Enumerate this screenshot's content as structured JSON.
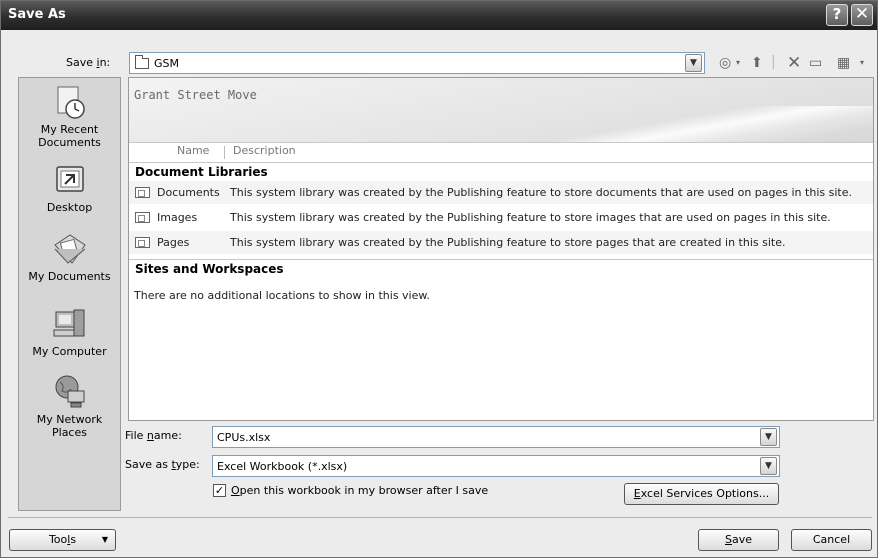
{
  "window": {
    "title": "Save As",
    "help_label": "?",
    "close_label": "✕"
  },
  "save_in": {
    "label_pre": "Save ",
    "label_key": "i",
    "label_post": "n:",
    "value": "GSM"
  },
  "places": [
    {
      "label": "My Recent Documents",
      "icon": "recent-documents-icon"
    },
    {
      "label": "Desktop",
      "icon": "desktop-icon"
    },
    {
      "label": "My Documents",
      "icon": "my-documents-icon"
    },
    {
      "label": "My Computer",
      "icon": "my-computer-icon"
    },
    {
      "label": "My Network Places",
      "icon": "network-places-icon"
    }
  ],
  "site": {
    "title": "Grant Street Move",
    "columns": [
      "Name",
      "Description"
    ],
    "groups": [
      {
        "heading": "Document Libraries",
        "rows": [
          {
            "name": "Documents",
            "description": "This system library was created by the Publishing feature to store documents that are used on pages in this site."
          },
          {
            "name": "Images",
            "description": "This system library was created by the Publishing feature to store images that are used on pages in this site."
          },
          {
            "name": "Pages",
            "description": "This system library was created by the Publishing feature to store pages that are created in this site."
          }
        ]
      },
      {
        "heading": "Sites and Workspaces",
        "empty_message": "There are no additional locations to show in this view."
      }
    ]
  },
  "file_name": {
    "label_pre": "File ",
    "label_key": "n",
    "label_post": "ame:",
    "value": "CPUs.xlsx"
  },
  "save_as_type": {
    "label_pre": "Save as ",
    "label_key": "t",
    "label_post": "ype:",
    "value": "Excel Workbook (*.xlsx)"
  },
  "open_in_browser": {
    "checked": true,
    "label_key": "O",
    "label_post": "pen this workbook in my browser after I save"
  },
  "buttons": {
    "excel_services_key": "E",
    "excel_services_post": "xcel Services Options...",
    "tools_pre": "Too",
    "tools_key": "l",
    "tools_post": "s",
    "save_key": "S",
    "save_post": "ave",
    "cancel": "Cancel"
  },
  "icons": {
    "dropdown": "chevron-down-icon",
    "back": "back-icon",
    "up_folder": "up-one-level-icon",
    "delete": "delete-icon",
    "new_folder": "new-folder-icon",
    "views": "views-icon"
  }
}
